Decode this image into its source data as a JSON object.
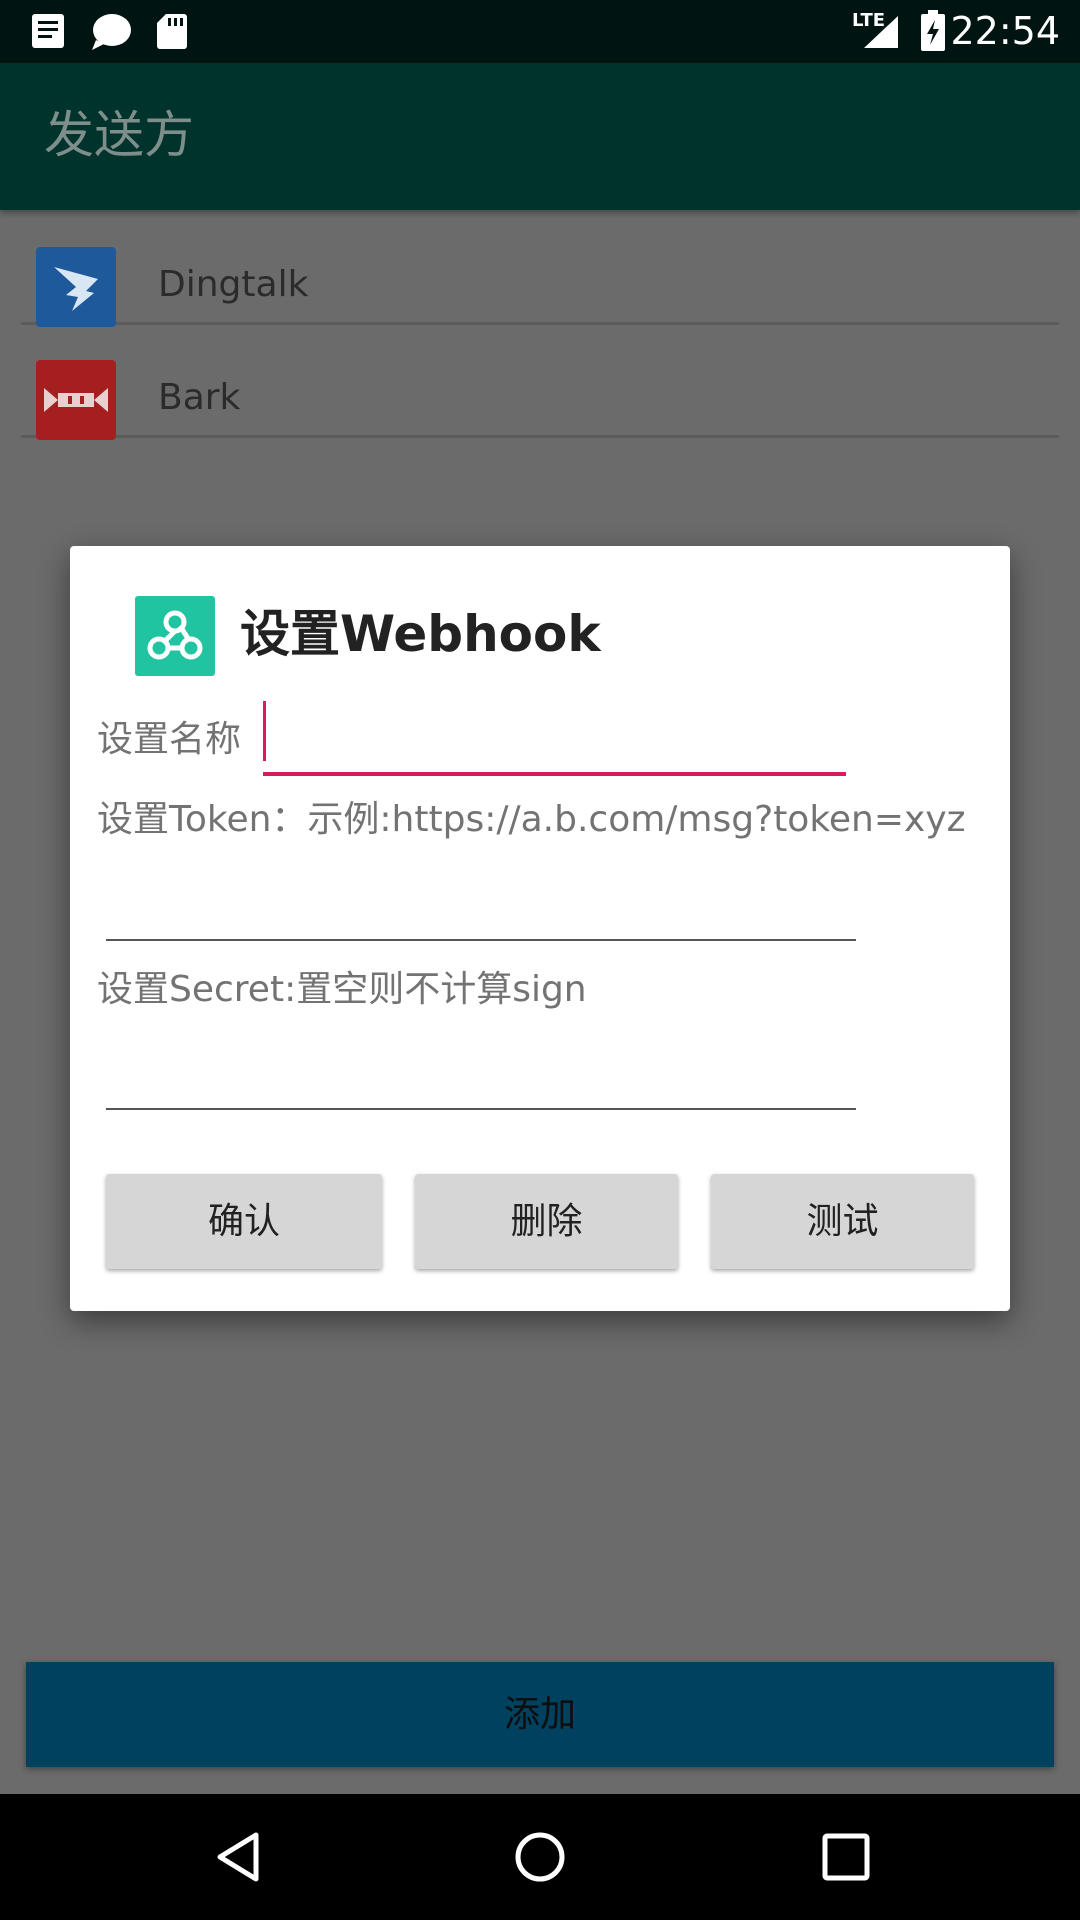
{
  "status_bar": {
    "time": "22:54",
    "network": "LTE",
    "icons": [
      "notes-icon",
      "chat-bubble-icon",
      "sd-card-icon",
      "signal-icon",
      "battery-charging-icon"
    ]
  },
  "app_bar": {
    "title": "发送方"
  },
  "senders": [
    {
      "label": "Dingtalk",
      "icon": "dingtalk-icon",
      "color": "#1e5a9b"
    },
    {
      "label": "Bark",
      "icon": "bark-icon",
      "color": "#a51f1f"
    }
  ],
  "add_button": {
    "label": "添加"
  },
  "dialog": {
    "title": "设置Webhook",
    "icon": "webhook-icon",
    "name_label": "设置名称",
    "name_value": "",
    "token_label": "设置Token：示例:https://a.b.com/msg?token=xyz",
    "token_value": "",
    "secret_label": "设置Secret:置空则不计算sign",
    "secret_value": "",
    "buttons": {
      "confirm": "确认",
      "delete": "删除",
      "test": "测试"
    }
  },
  "nav_bar": {
    "icons": [
      "back-icon",
      "home-icon",
      "recents-icon"
    ]
  }
}
